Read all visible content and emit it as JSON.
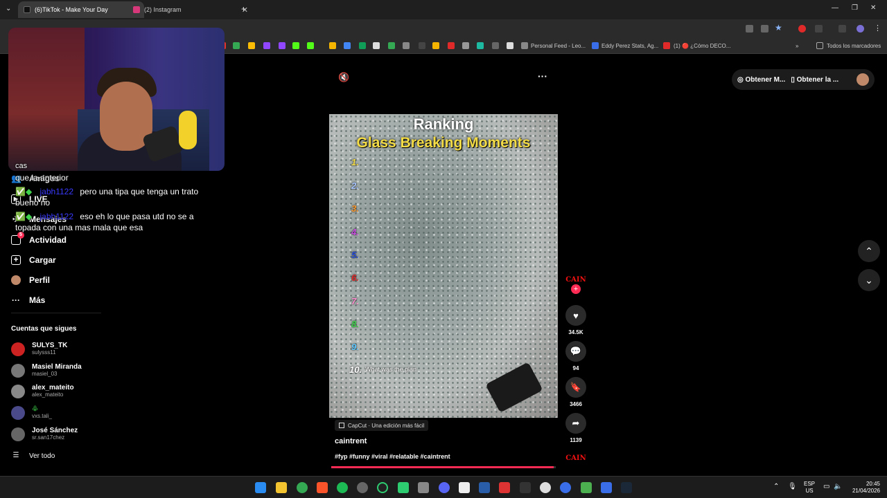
{
  "browser": {
    "tabs": [
      {
        "title": "(6)TikTok - Make Your Day",
        "active": true,
        "color": "#111111"
      },
      {
        "title": "(2) Instagram",
        "active": false,
        "color": "#d6387a"
      }
    ],
    "bookmarks": {
      "items": [
        "Personal Feed - Leo...",
        "Eddy Perez Stats, Ag...",
        "(1) 🔴 ¿Cómo DECO..."
      ],
      "all_label": "Todos los marcadores"
    }
  },
  "webcam": {
    "overlay_label": "cas"
  },
  "chat": {
    "messages": [
      {
        "line1": "que la anterior"
      },
      {
        "user": "jabh1122",
        "text": "pero una tipa que tenga un trato",
        "line2": "bueno no"
      },
      {
        "user": "jabh1122",
        "text": "eso eh lo que pasa utd no se a",
        "line2": "topada con una mas mala que esa"
      }
    ]
  },
  "sidebar": {
    "items": [
      {
        "label": "Amigos",
        "icon": "friends-icon"
      },
      {
        "label": "LIVE",
        "icon": "live-icon"
      },
      {
        "label": "Mensajes",
        "icon": "messages-icon"
      },
      {
        "label": "Actividad",
        "icon": "activity-icon",
        "badge": "5"
      },
      {
        "label": "Cargar",
        "icon": "upload-icon"
      },
      {
        "label": "Perfil",
        "icon": "profile-icon"
      },
      {
        "label": "Más",
        "icon": "more-icon"
      }
    ],
    "following_title": "Cuentas que sigues",
    "following": [
      {
        "name": "SULYS_TK",
        "handle": "sulysss11",
        "color": "#c22"
      },
      {
        "name": "Masiel Miranda",
        "handle": "masiel_03",
        "color": "#777"
      },
      {
        "name": "alex_mateito",
        "handle": "alex_mateito",
        "color": "#888"
      },
      {
        "name": "",
        "handle": "vxs.tali_",
        "color": "#555"
      },
      {
        "name": "José Sánchez",
        "handle": "sr.san17chez",
        "color": "#666"
      }
    ],
    "see_all": "Ver todo"
  },
  "video": {
    "title_line1": "Ranking",
    "title_line2": "Glass Breaking Moments",
    "ranks": [
      {
        "n": "1.",
        "color": "#f3dc45"
      },
      {
        "n": "2.",
        "color": "#a8c4ff"
      },
      {
        "n": "3.",
        "color": "#ff9a2e"
      },
      {
        "n": "4.",
        "color": "#c84ce0"
      },
      {
        "n": "5.",
        "color": "#2a4fd6"
      },
      {
        "n": "6.",
        "color": "#e02a2a"
      },
      {
        "n": "7.",
        "color": "#ff8fd0"
      },
      {
        "n": "8.",
        "color": "#3fd44c"
      },
      {
        "n": "9.",
        "color": "#5ec8ff"
      },
      {
        "n": "10.",
        "color": "#ffffff"
      }
    ],
    "rank10_text": "What was the plan",
    "capcut_label": "CapCut · Una edición más fácil",
    "author": "caintrent",
    "hashtags": "#fyp #funny #viral #relatable #caintrent",
    "progress": 0.99
  },
  "actions": {
    "avatar_text": "CAIN",
    "likes": "34.5K",
    "comments": "94",
    "saves": "3466",
    "shares": "1139",
    "next_avatar_text": "CAIN"
  },
  "header_right": {
    "btn1": "Obtener M...",
    "btn2": "Obtener la ..."
  },
  "taskbar": {
    "lang1": "ESP",
    "lang2": "US",
    "time": "20:45",
    "date": "21/04/2026"
  }
}
